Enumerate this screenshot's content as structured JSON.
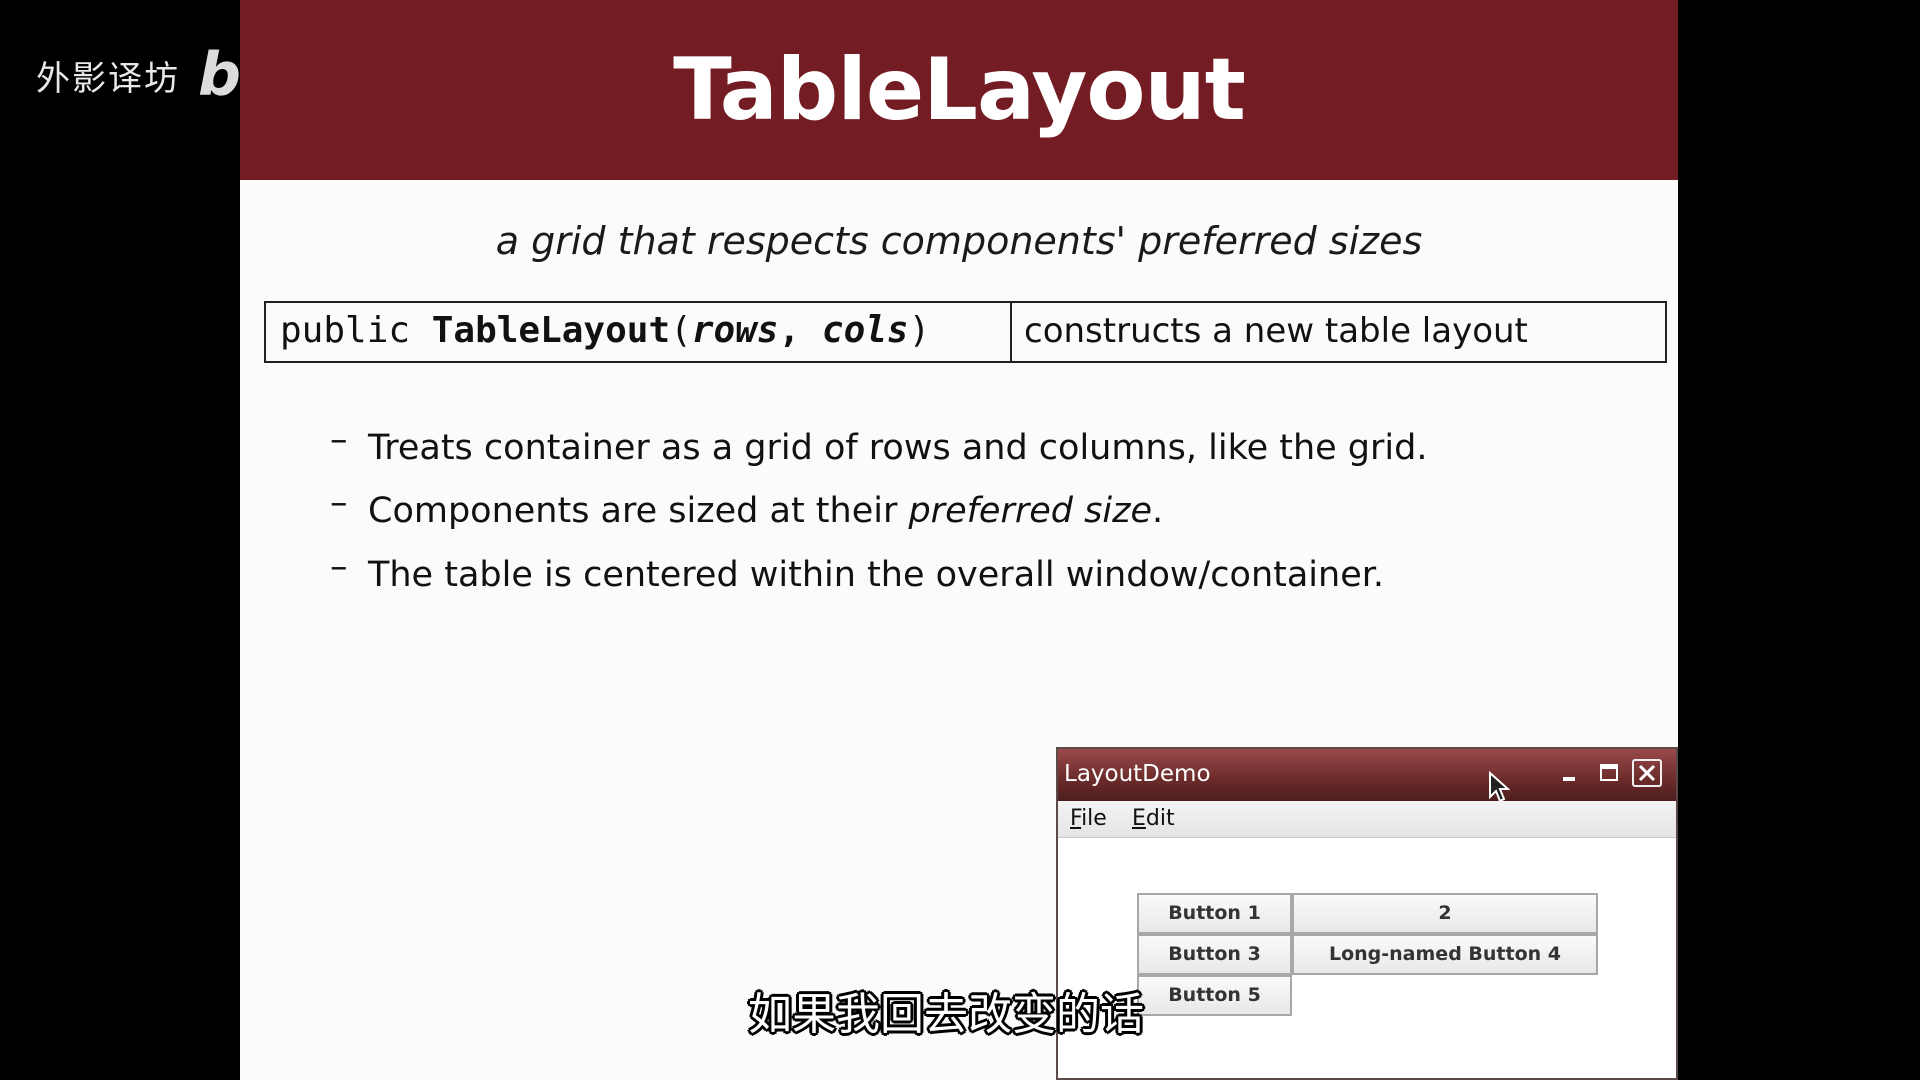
{
  "watermark": {
    "text": "外影译坊",
    "logo": "bilibili"
  },
  "slide": {
    "title": "TableLayout",
    "subtitle": "a grid that respects components' preferred sizes",
    "api": {
      "sig_public": "public ",
      "sig_method": "TableLayout",
      "sig_open": "(",
      "sig_rows": "rows",
      "sig_comma": ", ",
      "sig_cols": "cols",
      "sig_close": ")",
      "description": "constructs a new table layout"
    },
    "bullets": [
      {
        "dash": "–",
        "text": "Treats container as a grid of rows and columns, like the grid."
      },
      {
        "dash": "–",
        "text_before": "Components are sized at their ",
        "emphasis": "preferred size",
        "text_after": "."
      },
      {
        "dash": "–",
        "text": "The table is centered within the overall window/container."
      }
    ],
    "colors": {
      "header_bg": "#741c23",
      "title_fg": "#ffffff",
      "slide_bg": "#fbfbfa"
    }
  },
  "demo_window": {
    "title": "LayoutDemo",
    "controls": {
      "minimize": "minimize-icon",
      "maximize": "maximize-icon",
      "close": "close-icon"
    },
    "menu": {
      "file_mnemonic": "F",
      "file_rest": "ile",
      "edit_mnemonic": "E",
      "edit_rest": "dit"
    },
    "buttons": [
      "Button 1",
      "2",
      "Button 3",
      "Long-named Button 4",
      "Button 5"
    ]
  },
  "video_subtitle": "如果我回去改变的话"
}
